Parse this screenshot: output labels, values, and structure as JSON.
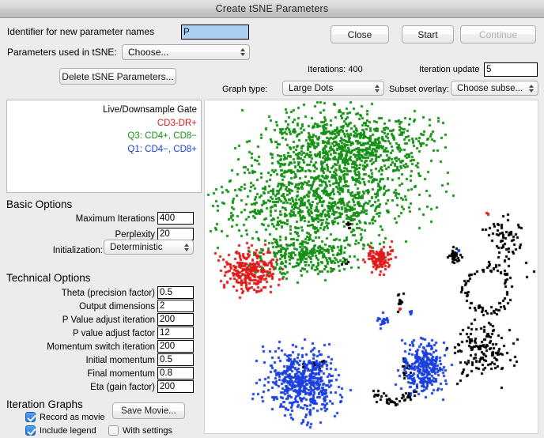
{
  "window": {
    "title": "Create tSNE Parameters"
  },
  "header": {
    "identifier_label": "Identifier for new parameter names",
    "identifier_value": "P",
    "params_used_label": "Parameters used in tSNE:",
    "params_used_value": "Choose...",
    "delete_button": "Delete tSNE Parameters...",
    "close_button": "Close",
    "start_button": "Start",
    "continue_button": "Continue",
    "iterations_label": "Iterations: 400",
    "iteration_update_label": "Iteration update",
    "iteration_update_value": "5",
    "graph_type_label": "Graph type:",
    "graph_type_value": "Large Dots",
    "subset_overlay_label": "Subset overlay:",
    "subset_overlay_value": "Choose subse..."
  },
  "legend": {
    "entries": [
      {
        "text": "Live/Downsample Gate",
        "color": "#000000"
      },
      {
        "text": "CD3-DR+",
        "color": "#e01b1b"
      },
      {
        "text": "Q3: CD4+, CD8−",
        "color": "#179017"
      },
      {
        "text": "Q1: CD4−, CD8+",
        "color": "#1a40e0"
      }
    ]
  },
  "basic_options": {
    "title": "Basic Options",
    "fields": [
      {
        "label": "Maximum Iterations",
        "value": "400"
      },
      {
        "label": "Perplexity",
        "value": "20"
      }
    ],
    "initialization_label": "Initialization:",
    "initialization_value": "Deterministic"
  },
  "technical_options": {
    "title": "Technical Options",
    "fields": [
      {
        "label": "Theta (precision factor)",
        "value": "0.5"
      },
      {
        "label": "Output dimensions",
        "value": "2"
      },
      {
        "label": "P Value adjust iteration",
        "value": "200"
      },
      {
        "label": "P value adjust factor",
        "value": "12"
      },
      {
        "label": "Momentum switch iteration",
        "value": "200"
      },
      {
        "label": "Initial momentum",
        "value": "0.5"
      },
      {
        "label": "Final momentum",
        "value": "0.8"
      },
      {
        "label": "Eta (gain factor)",
        "value": "200"
      }
    ]
  },
  "iteration_graphs": {
    "title": "Iteration Graphs",
    "record_as_movie": {
      "label": "Record as movie",
      "checked": true
    },
    "include_legend": {
      "label": "Include legend",
      "checked": true
    },
    "with_settings": {
      "label": "With settings",
      "checked": false
    },
    "save_movie_button": "Save Movie..."
  },
  "chart_data": {
    "type": "scatter",
    "title": "",
    "xlabel": "",
    "ylabel": "",
    "grid": false,
    "legend_position": "external-left",
    "point_size": 3,
    "series": [
      {
        "name": "Live/Downsample Gate",
        "color": "#000000",
        "n": 430,
        "clusters": [
          {
            "cx": 0.845,
            "cy": 0.565,
            "rx": 0.075,
            "ry": 0.075,
            "n": 80,
            "shape": "ring"
          },
          {
            "cx": 0.825,
            "cy": 0.745,
            "rx": 0.085,
            "ry": 0.085,
            "n": 150,
            "shape": "blob"
          },
          {
            "cx": 0.905,
            "cy": 0.425,
            "rx": 0.055,
            "ry": 0.085,
            "n": 70,
            "shape": "blob"
          },
          {
            "cx": 0.745,
            "cy": 0.465,
            "rx": 0.022,
            "ry": 0.022,
            "n": 30,
            "shape": "blob"
          },
          {
            "cx": 0.565,
            "cy": 0.88,
            "rx": 0.07,
            "ry": 0.02,
            "n": 45,
            "shape": "arc"
          },
          {
            "cx": 0.585,
            "cy": 0.6,
            "rx": 0.01,
            "ry": 0.028,
            "n": 12,
            "shape": "blob"
          },
          {
            "cx": 0.6,
            "cy": 0.79,
            "rx": 0.012,
            "ry": 0.03,
            "n": 14,
            "shape": "blob"
          },
          {
            "cx": 0.43,
            "cy": 0.37,
            "rx": 0.012,
            "ry": 0.012,
            "n": 8,
            "shape": "blob"
          },
          {
            "cx": 0.42,
            "cy": 0.48,
            "rx": 0.012,
            "ry": 0.012,
            "n": 6,
            "shape": "blob"
          },
          {
            "cx": 0.32,
            "cy": 0.79,
            "rx": 0.03,
            "ry": 0.018,
            "n": 14,
            "shape": "blob"
          }
        ]
      },
      {
        "name": "CD3-DR+",
        "color": "#e01b1b",
        "n": 420,
        "clusters": [
          {
            "cx": 0.135,
            "cy": 0.51,
            "rx": 0.075,
            "ry": 0.065,
            "n": 290,
            "shape": "blob"
          },
          {
            "cx": 0.52,
            "cy": 0.47,
            "rx": 0.038,
            "ry": 0.035,
            "n": 120,
            "shape": "blob"
          },
          {
            "cx": 0.845,
            "cy": 0.335,
            "rx": 0.006,
            "ry": 0.006,
            "n": 3,
            "shape": "blob"
          },
          {
            "cx": 0.585,
            "cy": 0.62,
            "rx": 0.005,
            "ry": 0.005,
            "n": 3,
            "shape": "blob"
          }
        ]
      },
      {
        "name": "Q3: CD4+, CD8−",
        "color": "#179017",
        "n": 2100,
        "clusters": [
          {
            "cx": 0.43,
            "cy": 0.135,
            "rx": 0.23,
            "ry": 0.105,
            "n": 900,
            "shape": "blob"
          },
          {
            "cx": 0.33,
            "cy": 0.3,
            "rx": 0.28,
            "ry": 0.12,
            "n": 900,
            "shape": "blob"
          },
          {
            "cx": 0.3,
            "cy": 0.46,
            "rx": 0.14,
            "ry": 0.06,
            "n": 300,
            "shape": "blob"
          }
        ]
      },
      {
        "name": "Q1: CD4−, CD8+",
        "color": "#1a40e0",
        "n": 900,
        "clusters": [
          {
            "cx": 0.29,
            "cy": 0.845,
            "rx": 0.1,
            "ry": 0.095,
            "n": 560,
            "shape": "blob"
          },
          {
            "cx": 0.655,
            "cy": 0.8,
            "rx": 0.06,
            "ry": 0.075,
            "n": 300,
            "shape": "blob"
          },
          {
            "cx": 0.535,
            "cy": 0.66,
            "rx": 0.022,
            "ry": 0.018,
            "n": 18,
            "shape": "blob"
          },
          {
            "cx": 0.615,
            "cy": 0.635,
            "rx": 0.008,
            "ry": 0.008,
            "n": 6,
            "shape": "blob"
          },
          {
            "cx": 0.76,
            "cy": 0.45,
            "rx": 0.006,
            "ry": 0.006,
            "n": 3,
            "shape": "blob"
          }
        ]
      }
    ]
  }
}
